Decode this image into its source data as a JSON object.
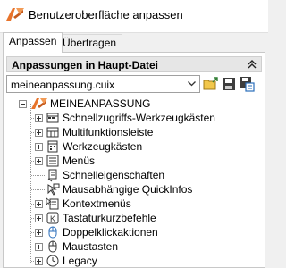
{
  "window": {
    "title": "Benutzeroberfläche anpassen"
  },
  "tabs": [
    {
      "label": "Anpassen",
      "active": true
    },
    {
      "label": "Übertragen",
      "active": false
    }
  ],
  "section": {
    "title": "Anpassungen in Haupt-Datei"
  },
  "file_select": {
    "value": "meineanpassung.cuix"
  },
  "toolbar": {
    "icons": [
      "open-file-icon",
      "save-icon",
      "save-as-icon"
    ]
  },
  "tree": {
    "root": {
      "label": "MEINEANPASSUNG",
      "icon": "autocad-logo-icon",
      "expanded": true
    },
    "items": [
      {
        "label": "Schnellzugriffs-Werkzeugkästen",
        "icon": "quick-access-toolbar-icon",
        "expandable": true
      },
      {
        "label": "Multifunktionsleiste",
        "icon": "ribbon-icon",
        "expandable": true
      },
      {
        "label": "Werkzeugkästen",
        "icon": "toolbars-icon",
        "expandable": true
      },
      {
        "label": "Menüs",
        "icon": "menus-icon",
        "expandable": true
      },
      {
        "label": "Schnelleigenschaften",
        "icon": "quick-properties-icon",
        "expandable": false
      },
      {
        "label": "Mausabhängige QuickInfos",
        "icon": "rollover-tooltips-icon",
        "expandable": false
      },
      {
        "label": "Kontextmenüs",
        "icon": "shortcut-menus-icon",
        "expandable": true
      },
      {
        "label": "Tastaturkurzbefehle",
        "icon": "keyboard-shortcuts-icon",
        "expandable": true
      },
      {
        "label": "Doppelklickaktionen",
        "icon": "double-click-actions-icon",
        "expandable": true
      },
      {
        "label": "Maustasten",
        "icon": "mouse-buttons-icon",
        "expandable": true
      },
      {
        "label": "Legacy",
        "icon": "legacy-icon",
        "expandable": true
      }
    ]
  },
  "colors": {
    "accent_orange": "#e8742b",
    "header_bg": "#e6e6e6",
    "window_bg": "#f0f0f0"
  }
}
